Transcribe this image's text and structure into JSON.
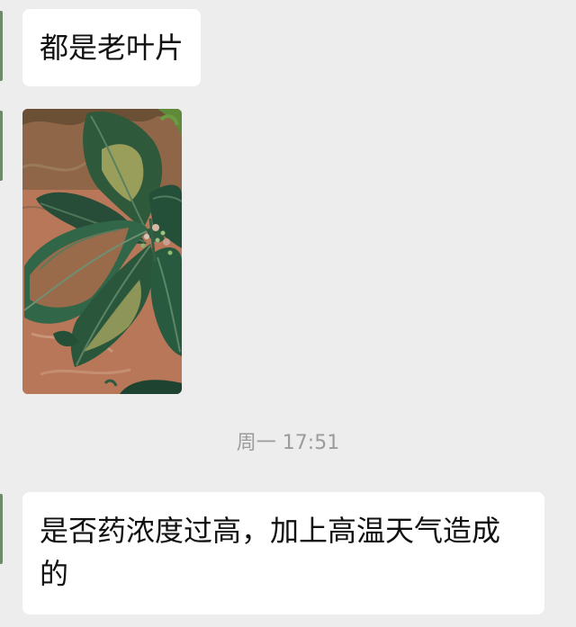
{
  "messages": [
    {
      "text": "都是老叶片"
    },
    {
      "image": "leaf-photo"
    },
    {
      "text": "是否药浓度过高，加上高温天气造成的"
    }
  ],
  "timestamp": "周一 17:51",
  "colors": {
    "background": "#ededed",
    "bubble": "#ffffff",
    "text": "#111111",
    "timestamp": "#9c9c9c"
  }
}
